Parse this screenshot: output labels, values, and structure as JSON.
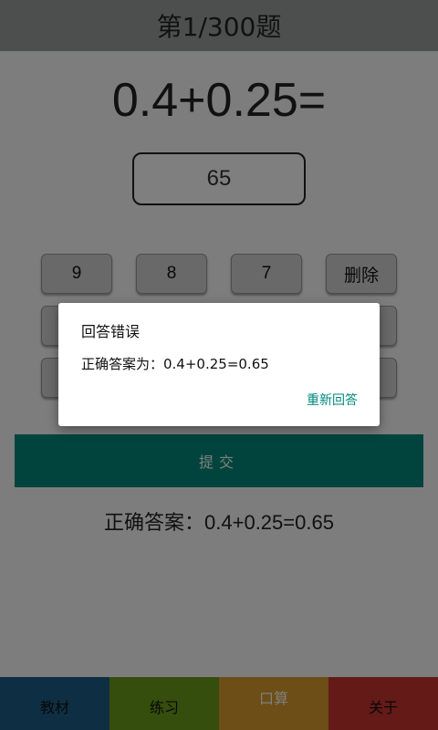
{
  "header": {
    "title": "第1/300题"
  },
  "question": {
    "text": "0.4+0.25="
  },
  "answer": {
    "value": "65"
  },
  "keypad": {
    "row1": [
      "9",
      "8",
      "7",
      "删除"
    ]
  },
  "submit": {
    "label": "提交"
  },
  "correct_answer_line": {
    "text": "正确答案：0.4+0.25=0.65"
  },
  "dialog": {
    "title": "回答错误",
    "message": "正确答案为：0.4+0.25=0.65",
    "button": "重新回答"
  },
  "bottom_nav": {
    "items": [
      {
        "label": "教材",
        "color": "#1d5f86"
      },
      {
        "label": "练习",
        "color": "#6a9a1a"
      },
      {
        "label": "口算",
        "color": "#d99c2c"
      },
      {
        "label": "关于",
        "color": "#c8342e"
      }
    ],
    "active_index": 2
  },
  "colors": {
    "accent": "#00897b",
    "header_bg": "#9a9e9c"
  }
}
